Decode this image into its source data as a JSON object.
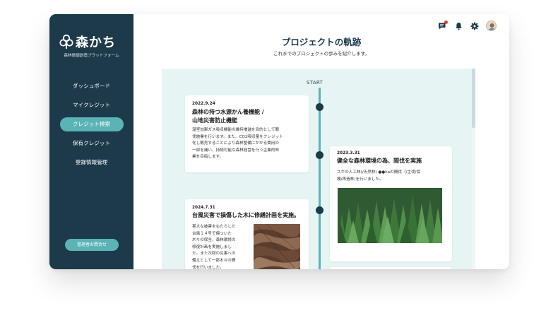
{
  "app": {
    "logo_text": "森かち",
    "logo_subtitle": "森林価値創造プラットフォーム"
  },
  "sidebar": {
    "items": [
      {
        "label": "ダッシュボード",
        "active": false
      },
      {
        "label": "マイクレジット",
        "active": false
      },
      {
        "label": "クレジット検索",
        "active": true
      },
      {
        "label": "保有クレジット",
        "active": false
      },
      {
        "label": "登録情報管理",
        "active": false
      }
    ],
    "admin_button": "管理者お問合せ"
  },
  "header": {
    "icons": [
      "chat-icon",
      "bell-icon",
      "gear-icon",
      "avatar"
    ],
    "notification_color": "#e53935"
  },
  "page": {
    "title": "プロジェクトの軌跡",
    "subtitle": "これまでのプロジェクトの歩みを紹介します。"
  },
  "timeline": {
    "start_label": "START",
    "entries": [
      {
        "date": "2022.9.24",
        "title": "森林の持つ水源かん養機能 /\n山地災害防止機能",
        "body": "温室効果ガス吸収機能の維持増進を目的として間\n伐施業を行います。また、CO2吸収量をクレジット\n化し販売することにより森林整備にかかる費用の\n一部を補い、持続可能な森林経営を行う企業的林\n業を目指します。"
      },
      {
        "date": "2023.3.31",
        "title": "健全な森林環境の為、間伐を実施",
        "body": "スギの人工林(/天然林) ●●haの間伐（/主伐/保\n護/再造林)を行いました。"
      },
      {
        "date": "2024.7.31",
        "title": "台風災害で損傷した木に修繕計画を実施。",
        "body": "甚大な被害をもたらした\n台風１４号で傷ついた\n木々の保全、森林環境の\n修復計画を実施しまし\nた。また次回の災害への\n備えとして一部木々の間\n伐を行いました。"
      }
    ]
  },
  "colors": {
    "sidebar_bg": "#1d3a4b",
    "accent": "#5bb3b5",
    "panel_bg": "#e6f4f3"
  }
}
